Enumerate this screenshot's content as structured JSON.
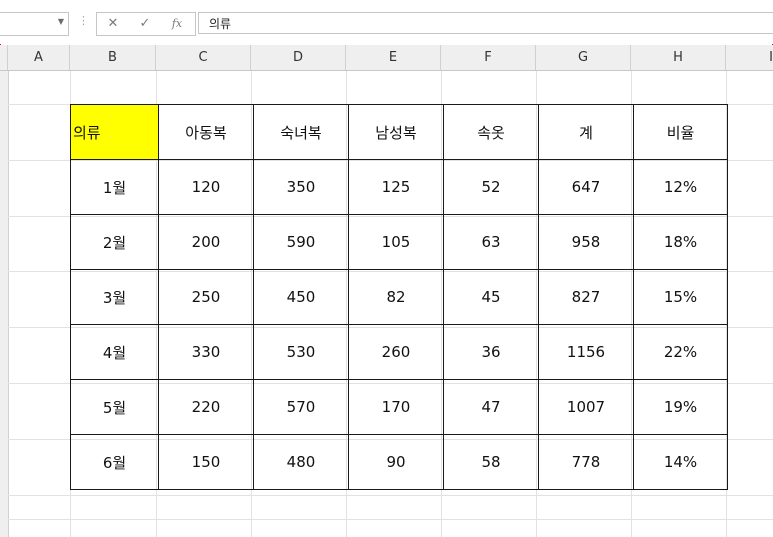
{
  "formula_bar": {
    "namebox_value": "",
    "cancel_icon": "✕",
    "enter_icon": "✓",
    "fx_icon": "fx",
    "content": "의류"
  },
  "columns": [
    "A",
    "B",
    "C",
    "D",
    "E",
    "F",
    "G",
    "H",
    "I"
  ],
  "table": {
    "header": [
      "의류",
      "아동복",
      "숙녀복",
      "남성복",
      "속옷",
      "계",
      "비율"
    ],
    "rows": [
      [
        "1월",
        "120",
        "350",
        "125",
        "52",
        "647",
        "12%"
      ],
      [
        "2월",
        "200",
        "590",
        "105",
        "63",
        "958",
        "18%"
      ],
      [
        "3월",
        "250",
        "450",
        "82",
        "45",
        "827",
        "15%"
      ],
      [
        "4월",
        "330",
        "530",
        "260",
        "36",
        "1156",
        "22%"
      ],
      [
        "5월",
        "220",
        "570",
        "170",
        "47",
        "1007",
        "19%"
      ],
      [
        "6월",
        "150",
        "480",
        "90",
        "58",
        "778",
        "14%"
      ]
    ],
    "highlight_color": "#ffff00"
  }
}
